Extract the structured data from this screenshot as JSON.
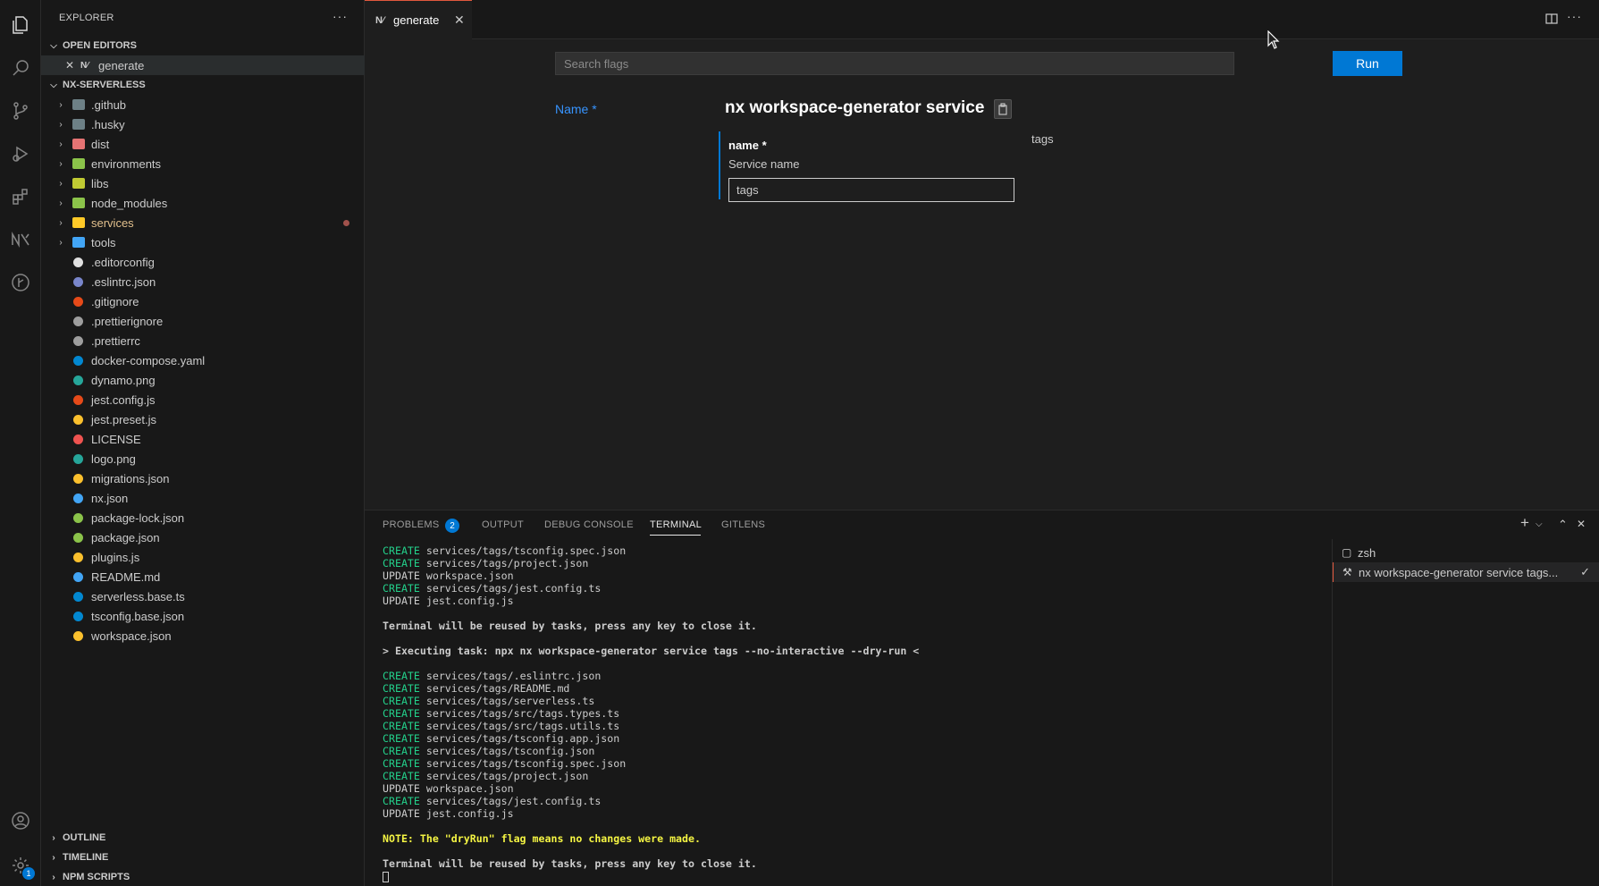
{
  "activity_bar": {
    "icons": [
      "files-icon",
      "search-icon",
      "source-control-icon",
      "run-debug-icon",
      "extensions-icon",
      "nx-console-icon",
      "gitlens-icon"
    ],
    "account_icon": "account-icon",
    "settings_icon": "gear-icon",
    "settings_badge": "1"
  },
  "sidebar": {
    "header": "EXPLORER",
    "more": "···",
    "open_editors_label": "OPEN EDITORS",
    "open_editor_item": {
      "close": "✕",
      "icon": "N⁄",
      "label": "generate"
    },
    "project_label": "NX-SERVERLESS",
    "folders": [
      {
        "label": ".github",
        "color": "#6d8086"
      },
      {
        "label": ".husky",
        "color": "#6d8086"
      },
      {
        "label": "dist",
        "color": "#e57373"
      },
      {
        "label": "environments",
        "color": "#8bc34a"
      },
      {
        "label": "libs",
        "color": "#c0ca33"
      },
      {
        "label": "node_modules",
        "color": "#8bc34a"
      },
      {
        "label": "services",
        "color": "#ffca28",
        "modified": true
      },
      {
        "label": "tools",
        "color": "#42a5f5"
      }
    ],
    "files": [
      {
        "label": ".editorconfig",
        "color": "#e0e0e0"
      },
      {
        "label": ".eslintrc.json",
        "color": "#7986cb"
      },
      {
        "label": ".gitignore",
        "color": "#e64a19"
      },
      {
        "label": ".prettierignore",
        "color": "#9e9e9e"
      },
      {
        "label": ".prettierrc",
        "color": "#9e9e9e"
      },
      {
        "label": "docker-compose.yaml",
        "color": "#0288d1"
      },
      {
        "label": "dynamo.png",
        "color": "#26a69a"
      },
      {
        "label": "jest.config.js",
        "color": "#e64a19"
      },
      {
        "label": "jest.preset.js",
        "color": "#fbc02d"
      },
      {
        "label": "LICENSE",
        "color": "#ef5350"
      },
      {
        "label": "logo.png",
        "color": "#26a69a"
      },
      {
        "label": "migrations.json",
        "color": "#fbc02d"
      },
      {
        "label": "nx.json",
        "color": "#42a5f5"
      },
      {
        "label": "package-lock.json",
        "color": "#8bc34a"
      },
      {
        "label": "package.json",
        "color": "#8bc34a"
      },
      {
        "label": "plugins.js",
        "color": "#fbc02d"
      },
      {
        "label": "README.md",
        "color": "#42a5f5"
      },
      {
        "label": "serverless.base.ts",
        "color": "#0288d1"
      },
      {
        "label": "tsconfig.base.json",
        "color": "#0288d1"
      },
      {
        "label": "workspace.json",
        "color": "#fbc02d"
      }
    ],
    "bottom_sections": [
      "OUTLINE",
      "TIMELINE",
      "NPM SCRIPTS"
    ]
  },
  "tabs": {
    "active": {
      "icon": "N⁄",
      "label": "generate",
      "close": "✕"
    }
  },
  "editor": {
    "search_placeholder": "Search flags",
    "run_label": "Run",
    "nav_name": "Name *",
    "title": "nx workspace-generator service",
    "field_name": "name *",
    "field_description": "Service name",
    "field_value": "tags",
    "side_label": "tags"
  },
  "panel": {
    "tabs": [
      "PROBLEMS",
      "OUTPUT",
      "DEBUG CONSOLE",
      "TERMINAL",
      "GITLENS"
    ],
    "active_tab": "TERMINAL",
    "problems_count": "2",
    "actions": {
      "add": "+",
      "dropdown": "⌵",
      "maximize": "⌃",
      "close": "✕"
    },
    "terminal_lines": [
      {
        "kw": "CREATE",
        "text": " services/tags/tsconfig.spec.json"
      },
      {
        "kw": "CREATE",
        "text": " services/tags/project.json"
      },
      {
        "kw": "",
        "text": "UPDATE workspace.json"
      },
      {
        "kw": "CREATE",
        "text": " services/tags/jest.config.ts"
      },
      {
        "kw": "",
        "text": "UPDATE jest.config.js"
      },
      {
        "kw": "",
        "text": ""
      },
      {
        "kw": "",
        "text": "Terminal will be reused by tasks, press any key to close it.",
        "bold": true
      },
      {
        "kw": "",
        "text": ""
      },
      {
        "kw": "",
        "text": "> Executing task: npx nx workspace-generator service tags --no-interactive --dry-run <",
        "bold": true
      },
      {
        "kw": "",
        "text": ""
      },
      {
        "kw": "CREATE",
        "text": " services/tags/.eslintrc.json"
      },
      {
        "kw": "CREATE",
        "text": " services/tags/README.md"
      },
      {
        "kw": "CREATE",
        "text": " services/tags/serverless.ts"
      },
      {
        "kw": "CREATE",
        "text": " services/tags/src/tags.types.ts"
      },
      {
        "kw": "CREATE",
        "text": " services/tags/src/tags.utils.ts"
      },
      {
        "kw": "CREATE",
        "text": " services/tags/tsconfig.app.json"
      },
      {
        "kw": "CREATE",
        "text": " services/tags/tsconfig.json"
      },
      {
        "kw": "CREATE",
        "text": " services/tags/tsconfig.spec.json"
      },
      {
        "kw": "CREATE",
        "text": " services/tags/project.json"
      },
      {
        "kw": "",
        "text": "UPDATE workspace.json"
      },
      {
        "kw": "CREATE",
        "text": " services/tags/jest.config.ts"
      },
      {
        "kw": "",
        "text": "UPDATE jest.config.js"
      },
      {
        "kw": "",
        "text": ""
      },
      {
        "kw": "",
        "text": "NOTE: The \"dryRun\" flag means no changes were made.",
        "note": true
      },
      {
        "kw": "",
        "text": ""
      },
      {
        "kw": "",
        "text": "Terminal will be reused by tasks, press any key to close it.",
        "bold": true
      }
    ],
    "terminal_list": [
      {
        "icon": "▢",
        "label": "zsh"
      },
      {
        "icon": "⚒",
        "label": "nx workspace-generator service tags...",
        "check": "✓",
        "active": true
      }
    ]
  }
}
